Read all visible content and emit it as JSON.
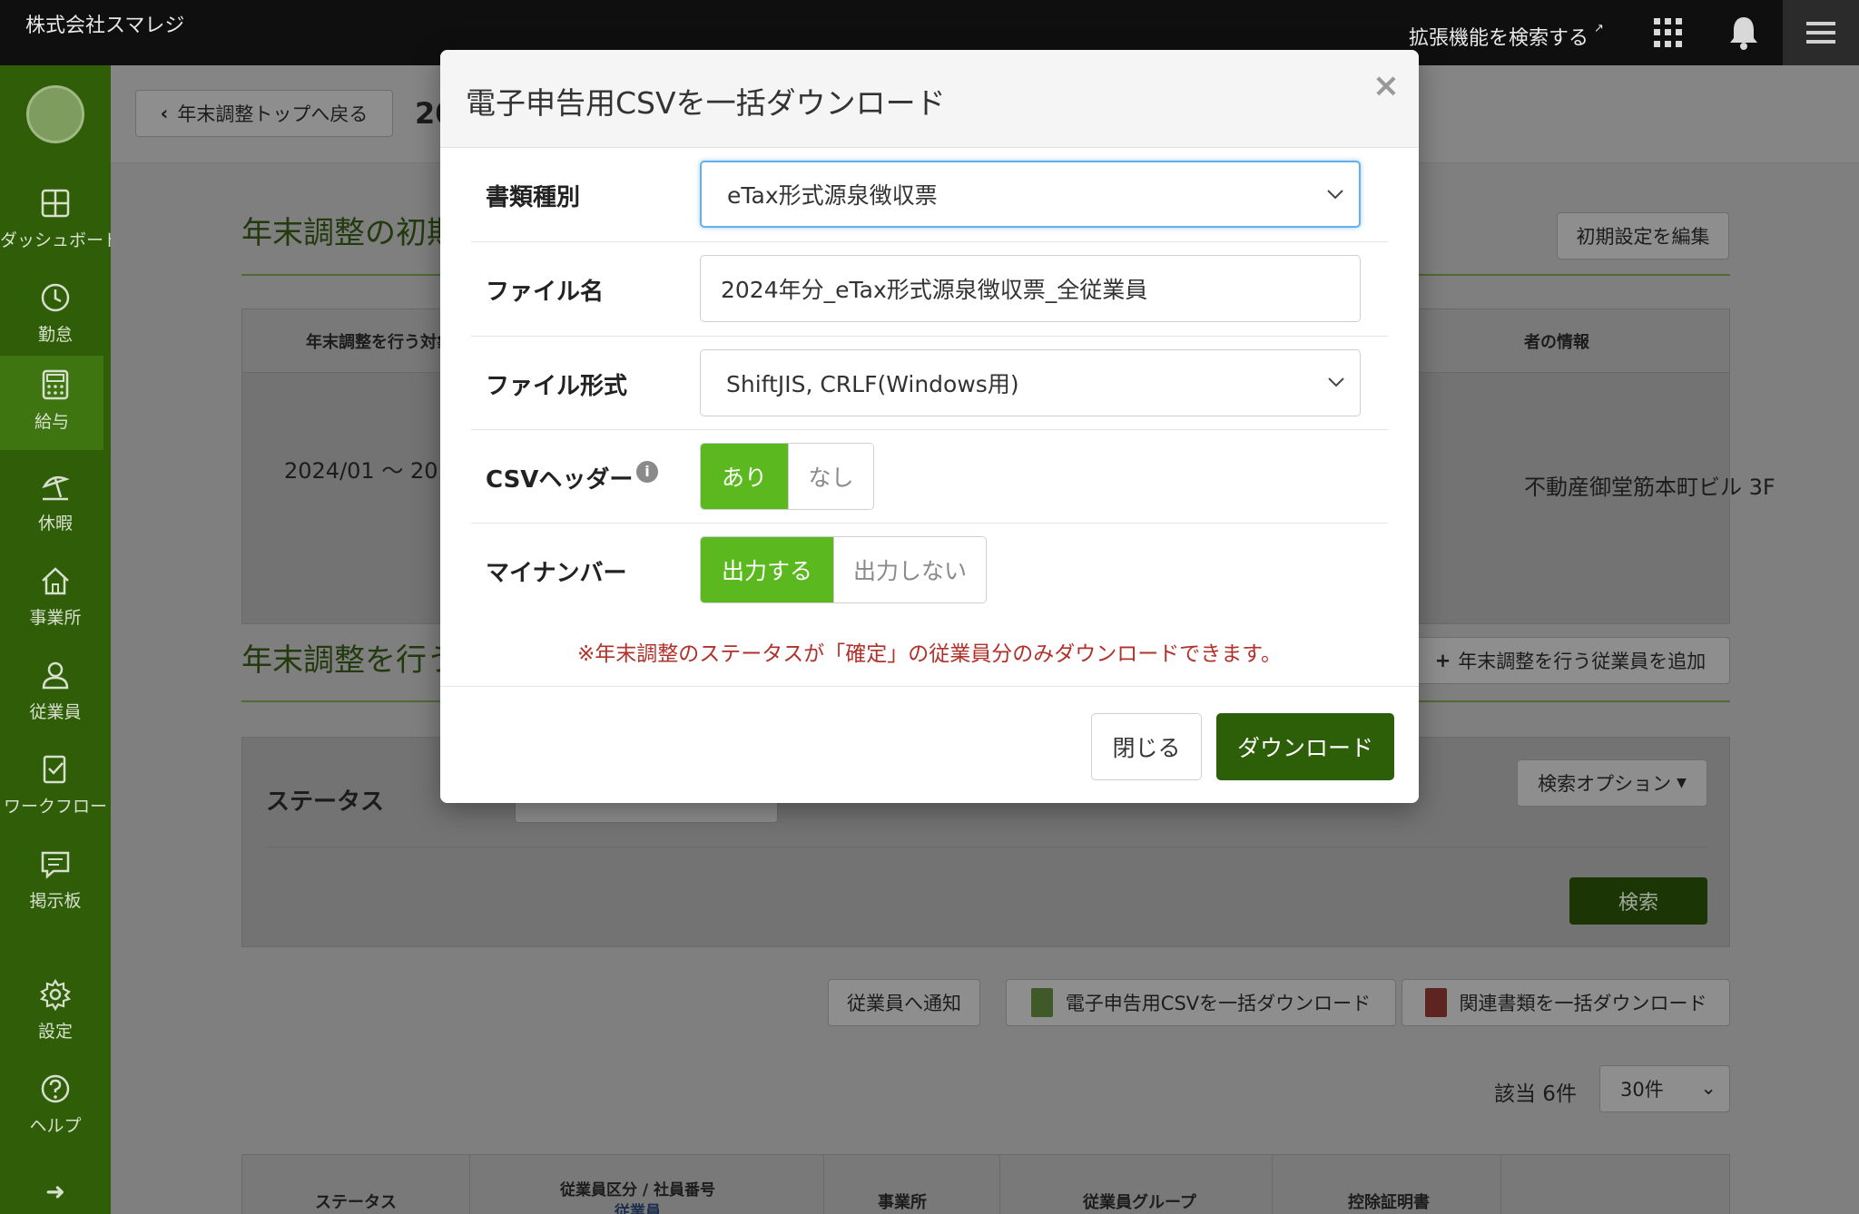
{
  "topbar": {
    "company": "株式会社スマレジ",
    "ext_search": "拡張機能を検索する"
  },
  "sidebar": {
    "items": [
      {
        "label": "ダッシュボード",
        "icon": "dashboard-icon"
      },
      {
        "label": "勤怠",
        "icon": "clock-icon"
      },
      {
        "label": "給与",
        "icon": "calculator-icon"
      },
      {
        "label": "休暇",
        "icon": "beach-umbrella-icon"
      },
      {
        "label": "事業所",
        "icon": "home-icon"
      },
      {
        "label": "従業員",
        "icon": "user-icon"
      },
      {
        "label": "ワークフロー",
        "icon": "workflow-icon"
      },
      {
        "label": "掲示板",
        "icon": "message-board-icon"
      },
      {
        "label": "設定",
        "icon": "gear-icon"
      },
      {
        "label": "ヘルプ",
        "icon": "help-icon"
      }
    ],
    "expand_icon": "arrow-right-icon"
  },
  "page": {
    "back_button": "年末調整トップへ戻る",
    "title_partial": "20",
    "section1_title": "年末調整の初期",
    "edit_settings_button": "初期設定を編集",
    "table_header_left": "年末調整を行う対象",
    "table_header_right": "者の情報",
    "period_text": "2024/01 ～ 20",
    "address_text": "不動産御堂筋本町ビル 3F",
    "section2_title": "年末調整を行う",
    "add_employee_button": "年末調整を行う従業員を追加",
    "status_label": "ステータス",
    "search_options_button": "検索オプション",
    "search_button": "検索",
    "notify_button": "従業員へ通知",
    "csv_bulk_button": "電子申告用CSVを一括ダウンロード",
    "pdf_bulk_button": "関連書類を一括ダウンロード",
    "result_count": "該当 6件",
    "per_page": "30件",
    "bottom_headers": [
      "ステータス",
      "従業員区分 / 社員番号",
      "従業員",
      "事業所",
      "従業員グループ",
      "控除証明書"
    ]
  },
  "modal": {
    "title": "電子申告用CSVを一括ダウンロード",
    "close_symbol": "×",
    "doc_type_label": "書類種別",
    "doc_type_value": "eTax形式源泉徴収票",
    "filename_label": "ファイル名",
    "filename_value": "2024年分_eTax形式源泉徴収票_全従業員",
    "format_label": "ファイル形式",
    "format_value": "ShiftJIS, CRLF(Windows用)",
    "header_label": "CSVヘッダー",
    "header_on": "あり",
    "header_off": "なし",
    "mynumber_label": "マイナンバー",
    "mynumber_on": "出力する",
    "mynumber_off": "出力しない",
    "notice": "※年末調整のステータスが「確定」の従業員分のみダウンロードできます。",
    "close_button": "閉じる",
    "download_button": "ダウンロード"
  },
  "colors": {
    "topbar": "#0f0f0f",
    "sidebar": "#2f5d08",
    "toggle_active": "#5bb81e",
    "primary_button": "#2d5f09",
    "notice_text": "#b2302a",
    "focus_border": "#66afe9"
  }
}
